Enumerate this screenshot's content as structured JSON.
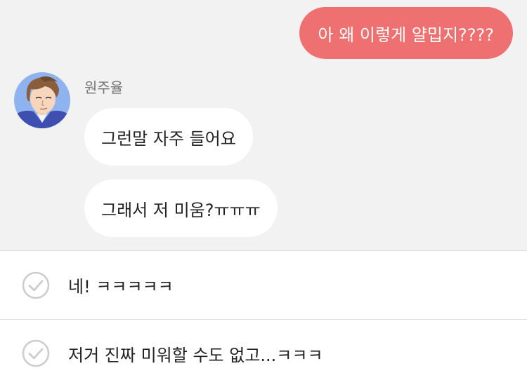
{
  "chat": {
    "outgoing": [
      {
        "text": "아 왜 이렇게 얄밉지????"
      }
    ],
    "sender": {
      "name": "원주율",
      "avatar_icon": "character-portrait-avatar"
    },
    "incoming": [
      {
        "text": "그런말 자주 들어요"
      },
      {
        "text": "그래서 저 미움?ㅠㅠㅠ"
      }
    ]
  },
  "choices": [
    {
      "text": "네! ㅋㅋㅋㅋㅋ",
      "icon": "check-circle-icon"
    },
    {
      "text": "저거 진짜 미워할 수도 없고...ㅋㅋㅋ",
      "icon": "check-circle-icon"
    }
  ],
  "colors": {
    "chat_background": "#f2f2f2",
    "outgoing_bubble": "#ee7070",
    "incoming_bubble": "#ffffff",
    "check_icon": "#cccccc"
  }
}
